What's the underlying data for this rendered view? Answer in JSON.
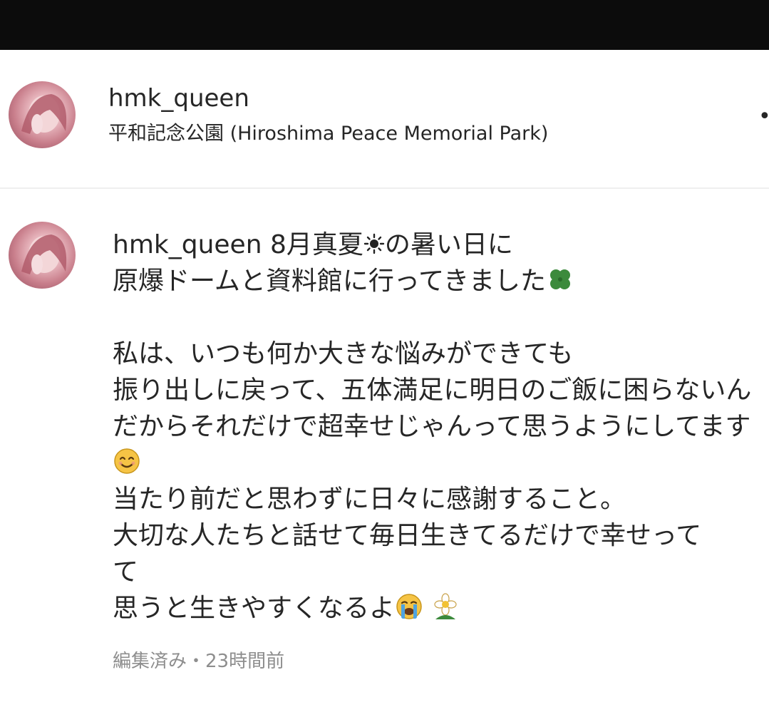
{
  "post_header": {
    "username": "hmk_queen",
    "location": "平和記念公園 (Hiroshima Peace Memorial Park)",
    "more_glyph": "•"
  },
  "caption": {
    "username": "hmk_queen",
    "text_part1": "8月真夏",
    "text_part2": "の暑い日に\n原爆ドームと資料館に行ってきました",
    "text_part3": "\n\n私は、いつも何か大きな悩みができても\n振り出しに戻って、五体満足に明日のご飯に困らないんだからそれだけで超幸せじゃんって思うようにしてます",
    "text_part4": "\n当たり前だと思わずに日々に感謝すること。\n大切な人たちと話せて毎日生きてるだけで幸せって\nて\n思うと生きやすくなるよ",
    "emojis": [
      "sun-icon",
      "four-leaf-clover-icon",
      "smiling-face-icon",
      "crying-face-icon",
      "flower-icon"
    ]
  },
  "meta": {
    "status": "編集済み・23時間前"
  },
  "colors": {
    "topbar": "#0c0c0c",
    "text": "#262626",
    "meta": "#8e8e8e"
  }
}
